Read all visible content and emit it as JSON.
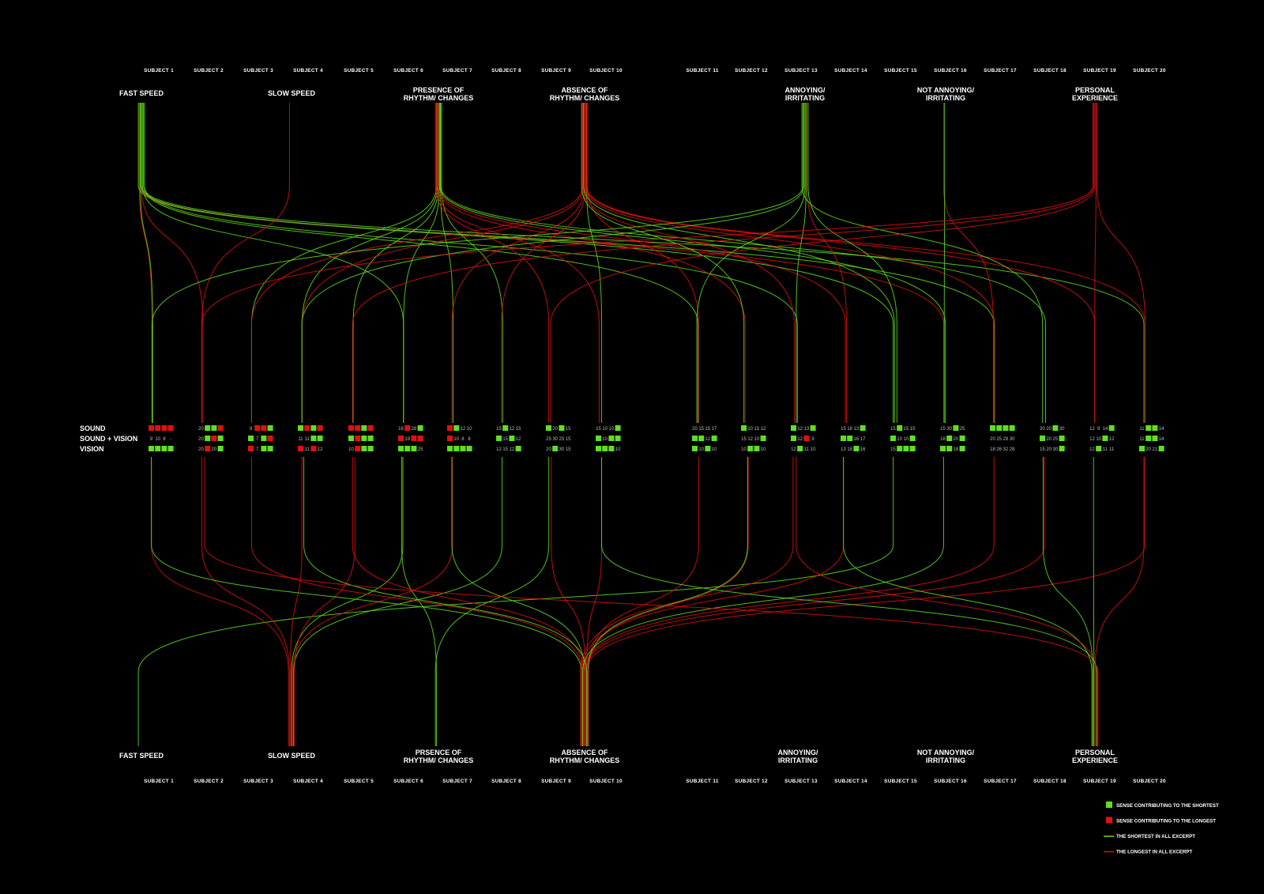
{
  "subjects": [
    "SUBJECT 1",
    "SUBJECT 2",
    "SUBJECT 3",
    "SUBJECT 4",
    "SUBJECT 5",
    "SUBJECT 6",
    "SUBJECT 7",
    "SUBJECT 8",
    "SUBJECT 9",
    "SUBJECT 10",
    "SUBJECT 11",
    "SUBJECT 12",
    "SUBJECT 13",
    "SUBJECT 14",
    "SUBJECT 15",
    "SUBJECT 16",
    "SUBJECT 17",
    "SUBJECT 18",
    "SUBJECT 19",
    "SUBJECT 20"
  ],
  "top_categories": [
    {
      "id": "fast",
      "lines": [
        "FAST SPEED"
      ]
    },
    {
      "id": "slow",
      "lines": [
        "SLOW SPEED"
      ]
    },
    {
      "id": "presence",
      "lines": [
        "PRESENCE OF",
        "RHYTHM/ CHANGES"
      ]
    },
    {
      "id": "absence",
      "lines": [
        "ABSENCE OF",
        "RHYTHM/ CHANGES"
      ]
    },
    {
      "id": "annoying",
      "lines": [
        "ANNOYING/",
        "IRRITATING"
      ]
    },
    {
      "id": "notannoying",
      "lines": [
        "NOT ANNOYING/",
        "IRRITATING"
      ]
    },
    {
      "id": "personal",
      "lines": [
        "PERSONAL",
        "EXPERIENCE"
      ]
    }
  ],
  "bottom_categories": [
    {
      "id": "fast",
      "lines": [
        "FAST SPEED"
      ]
    },
    {
      "id": "slow",
      "lines": [
        "SLOW SPEED"
      ]
    },
    {
      "id": "presence",
      "lines": [
        "PRSENCE OF",
        "RHYTHM/ CHANGES"
      ]
    },
    {
      "id": "absence",
      "lines": [
        "ABSENCE OF",
        "RHYTHM/ CHANGES"
      ]
    },
    {
      "id": "annoying",
      "lines": [
        "ANNOYING/",
        "IRRITATING"
      ]
    },
    {
      "id": "notannoying",
      "lines": [
        "NOT ANNOYING/",
        "IRRITATING"
      ]
    },
    {
      "id": "personal",
      "lines": [
        "PERSONAL",
        "EXPERIENCE"
      ]
    }
  ],
  "row_labels": [
    "SOUND",
    "SOUND + VISION",
    "VISION"
  ],
  "cells": [
    [
      [
        "r",
        "r",
        "r",
        "r"
      ],
      [
        "9",
        "10",
        "8",
        "-"
      ],
      [
        "g",
        "g",
        "g",
        "g"
      ]
    ],
    [
      [
        "20",
        "g",
        "g",
        "r"
      ],
      [
        "20",
        "g",
        "r",
        "g"
      ],
      [
        "20",
        "r",
        "20",
        "g"
      ]
    ],
    [
      [
        "9",
        "r",
        "r",
        "g"
      ],
      [
        "g",
        "7",
        "g",
        "r"
      ],
      [
        "r",
        "7",
        "g",
        "g"
      ]
    ],
    [
      [
        "g",
        "r",
        "g",
        "r"
      ],
      [
        "11",
        "11",
        "g",
        "g"
      ],
      [
        "r",
        "11",
        "r",
        "12"
      ]
    ],
    [
      [
        "r",
        "r",
        "g",
        "r"
      ],
      [
        "g",
        "r",
        "g",
        "g"
      ],
      [
        "10",
        "r",
        "g",
        "g"
      ]
    ],
    [
      [
        "16",
        "r",
        "28",
        "g"
      ],
      [
        "r",
        "19",
        "r",
        "r"
      ],
      [
        "g",
        "g",
        "g",
        "25"
      ]
    ],
    [
      [
        "r",
        "g",
        "12",
        "10"
      ],
      [
        "r",
        "10",
        "8",
        "8"
      ],
      [
        "g",
        "g",
        "g",
        "g"
      ]
    ],
    [
      [
        "15",
        "g",
        "12",
        "15"
      ],
      [
        "g",
        "15",
        "g",
        "12"
      ],
      [
        "12",
        "15",
        "12",
        "g"
      ]
    ],
    [
      [
        "g",
        "20",
        "g",
        "15"
      ],
      [
        "25",
        "30",
        "25",
        "15"
      ],
      [
        "20",
        "g",
        "30",
        "15"
      ]
    ],
    [
      [
        "15",
        "10",
        "10",
        "g"
      ],
      [
        "g",
        "10",
        "g",
        "g"
      ],
      [
        "g",
        "g",
        "g",
        "10"
      ]
    ],
    [
      [
        "20",
        "15",
        "15",
        "17"
      ],
      [
        "g",
        "g",
        "12",
        "g"
      ],
      [
        "g",
        "10",
        "g",
        "10"
      ]
    ],
    [
      [
        "g",
        "10",
        "15",
        "12"
      ],
      [
        "15",
        "12",
        "10",
        "g"
      ],
      [
        "10",
        "g",
        "g",
        "10"
      ]
    ],
    [
      [
        "g",
        "12",
        "13",
        "g"
      ],
      [
        "g",
        "12",
        "r",
        "9"
      ],
      [
        "12",
        "g",
        "11",
        "10"
      ]
    ],
    [
      [
        "15",
        "18",
        "13",
        "g"
      ],
      [
        "g",
        "g",
        "16",
        "17"
      ],
      [
        "13",
        "18",
        "g",
        "16"
      ]
    ],
    [
      [
        "15",
        "g",
        "15",
        "15"
      ],
      [
        "g",
        "10",
        "10",
        "g"
      ],
      [
        "15",
        "g",
        "g",
        "g"
      ]
    ],
    [
      [
        "15",
        "30",
        "g",
        "25"
      ],
      [
        "18",
        "g",
        "20",
        "g"
      ],
      [
        "g",
        "g",
        "18",
        "g"
      ]
    ],
    [
      [
        "g",
        "g",
        "g",
        "g"
      ],
      [
        "20",
        "25",
        "28",
        "30"
      ],
      [
        "18",
        "26",
        "32",
        "28"
      ]
    ],
    [
      [
        "30",
        "20",
        "g",
        "30"
      ],
      [
        "g",
        "20",
        "25",
        "g"
      ],
      [
        "15",
        "20",
        "30",
        "g"
      ]
    ],
    [
      [
        "12",
        "9",
        "14",
        "g"
      ],
      [
        "12",
        "10",
        "g",
        "12"
      ],
      [
        "12",
        "g",
        "11",
        "11"
      ]
    ],
    [
      [
        "11",
        "g",
        "g",
        "14"
      ],
      [
        "11",
        "g",
        "g",
        "14"
      ],
      [
        "g",
        "20",
        "21",
        "g"
      ]
    ]
  ],
  "cell_red_numbers": [
    [
      "15",
      "10",
      "12",
      "13",
      "14",
      "16",
      "17",
      "18",
      "20",
      "25",
      "26",
      "28",
      "30",
      "32",
      "9",
      "11",
      "21"
    ]
  ],
  "colors": {
    "green": "#5fe01e",
    "red": "#e01010",
    "orange": "#d98a12",
    "background": "#000000"
  },
  "legend": [
    {
      "kind": "square",
      "color": "green",
      "label": "SENSE CONTRIBUTING TO THE SHORTEST"
    },
    {
      "kind": "square",
      "color": "red",
      "label": "SENSE CONTRIBUTING TO THE LONGEST"
    },
    {
      "kind": "line",
      "color": "green",
      "label": "THE SHORTEST IN ALL EXCERPT"
    },
    {
      "kind": "line",
      "color": "red",
      "label": "THE LONGEST IN ALL EXCERPT"
    }
  ],
  "top_links": [
    [
      "fast",
      0,
      "r"
    ],
    [
      "fast",
      0,
      "g"
    ],
    [
      "fast",
      1,
      "r"
    ],
    [
      "fast",
      5,
      "g"
    ],
    [
      "fast",
      10,
      "g"
    ],
    [
      "fast",
      12,
      "g"
    ],
    [
      "fast",
      14,
      "g"
    ],
    [
      "fast",
      15,
      "r"
    ],
    [
      "fast",
      16,
      "g"
    ],
    [
      "fast",
      19,
      "g"
    ],
    [
      "slow",
      1,
      "r"
    ],
    [
      "presence",
      2,
      "g"
    ],
    [
      "presence",
      3,
      "g"
    ],
    [
      "presence",
      4,
      "g"
    ],
    [
      "presence",
      5,
      "g"
    ],
    [
      "presence",
      6,
      "g"
    ],
    [
      "presence",
      7,
      "g"
    ],
    [
      "presence",
      8,
      "r"
    ],
    [
      "presence",
      9,
      "r"
    ],
    [
      "presence",
      11,
      "r"
    ],
    [
      "presence",
      13,
      "r"
    ],
    [
      "presence",
      15,
      "g"
    ],
    [
      "presence",
      17,
      "g"
    ],
    [
      "absence",
      2,
      "r"
    ],
    [
      "absence",
      3,
      "r"
    ],
    [
      "absence",
      6,
      "r"
    ],
    [
      "absence",
      7,
      "r"
    ],
    [
      "absence",
      9,
      "g"
    ],
    [
      "absence",
      10,
      "r"
    ],
    [
      "absence",
      11,
      "g"
    ],
    [
      "absence",
      12,
      "r"
    ],
    [
      "absence",
      14,
      "g"
    ],
    [
      "absence",
      16,
      "r"
    ],
    [
      "absence",
      18,
      "r"
    ],
    [
      "absence",
      19,
      "r"
    ],
    [
      "annoying",
      0,
      "g"
    ],
    [
      "annoying",
      3,
      "g"
    ],
    [
      "annoying",
      10,
      "g"
    ],
    [
      "annoying",
      12,
      "g"
    ],
    [
      "annoying",
      13,
      "r"
    ],
    [
      "annoying",
      14,
      "g"
    ],
    [
      "annoying",
      17,
      "g"
    ],
    [
      "notannoying",
      16,
      "r"
    ],
    [
      "notannoying",
      15,
      "g"
    ],
    [
      "personal",
      1,
      "r"
    ],
    [
      "personal",
      4,
      "r"
    ],
    [
      "personal",
      8,
      "r"
    ],
    [
      "personal",
      18,
      "r"
    ],
    [
      "personal",
      19,
      "r"
    ]
  ],
  "bottom_links": [
    [
      "fast",
      14,
      "g"
    ],
    [
      "slow",
      0,
      "r"
    ],
    [
      "slow",
      1,
      "r"
    ],
    [
      "slow",
      3,
      "r"
    ],
    [
      "slow",
      5,
      "g"
    ],
    [
      "slow",
      6,
      "r"
    ],
    [
      "slow",
      7,
      "g"
    ],
    [
      "slow",
      4,
      "r"
    ],
    [
      "presence",
      8,
      "g"
    ],
    [
      "presence",
      5,
      "g"
    ],
    [
      "absence",
      0,
      "g"
    ],
    [
      "absence",
      2,
      "r"
    ],
    [
      "absence",
      4,
      "r"
    ],
    [
      "absence",
      6,
      "g"
    ],
    [
      "absence",
      8,
      "r"
    ],
    [
      "absence",
      9,
      "r"
    ],
    [
      "absence",
      10,
      "r"
    ],
    [
      "absence",
      11,
      "r"
    ],
    [
      "absence",
      12,
      "r"
    ],
    [
      "absence",
      13,
      "r"
    ],
    [
      "absence",
      15,
      "g"
    ],
    [
      "absence",
      16,
      "r"
    ],
    [
      "absence",
      17,
      "r"
    ],
    [
      "absence",
      19,
      "r"
    ],
    [
      "absence",
      3,
      "g"
    ],
    [
      "absence",
      11,
      "g"
    ],
    [
      "personal",
      13,
      "g"
    ],
    [
      "personal",
      17,
      "g"
    ],
    [
      "personal",
      18,
      "g"
    ],
    [
      "personal",
      19,
      "r"
    ],
    [
      "personal",
      12,
      "r"
    ],
    [
      "personal",
      9,
      "g"
    ],
    [
      "personal",
      1,
      "r"
    ]
  ]
}
